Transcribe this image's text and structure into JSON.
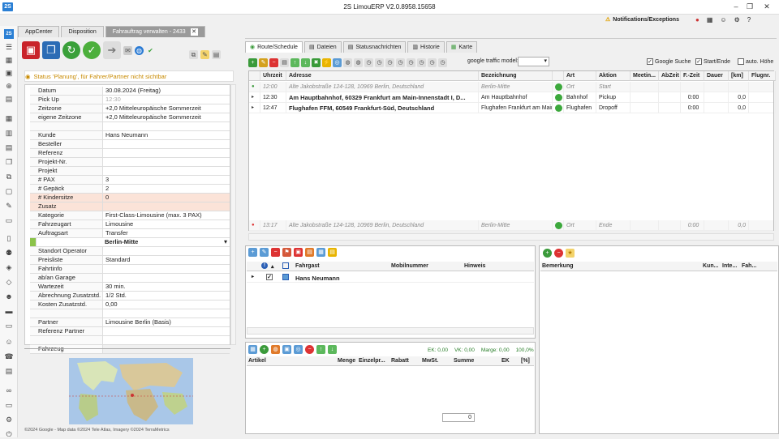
{
  "window": {
    "title": "2S LimouERP V2.0.8958.15658",
    "logo": "2S",
    "notif_label": "Notifications/Exceptions"
  },
  "tabs": [
    {
      "label": "AppCenter"
    },
    {
      "label": "Disposition"
    },
    {
      "label": "Fahrauftrag verwalten - 2433"
    }
  ],
  "status_text": "Status 'Planung', für Fahrer/Partner nicht sichtbar",
  "form": [
    {
      "label": "Datum",
      "value": "30.08.2024 (Freitag)"
    },
    {
      "label": "Pick Up",
      "value": "12:30",
      "style": "gray"
    },
    {
      "label": "Zeitzone",
      "value": "+2,0 Mitteleuropäische Sommerzeit"
    },
    {
      "label": "eigene Zeitzone",
      "value": "+2,0 Mitteleuropäische Sommerzeit"
    },
    {
      "label": "",
      "value": ""
    },
    {
      "label": "Kunde",
      "value": "Hans Neumann"
    },
    {
      "label": "Besteller",
      "value": ""
    },
    {
      "label": "Referenz",
      "value": ""
    },
    {
      "label": "Projekt-Nr.",
      "value": ""
    },
    {
      "label": "Projekt",
      "value": ""
    },
    {
      "label": "# PAX",
      "value": "3"
    },
    {
      "label": "# Gepäck",
      "value": "2"
    },
    {
      "label": "# Kindersitze",
      "value": "0",
      "style": "pink"
    },
    {
      "label": "Zusatz",
      "value": "",
      "style": "pink"
    },
    {
      "label": "Kategorie",
      "value": "First-Class-Limousine (max. 3 PAX)"
    },
    {
      "label": "Fahrzeugart",
      "value": "Limousine"
    },
    {
      "label": "Auftragsart",
      "value": "Transfer"
    },
    {
      "label": "",
      "value": "Berlin-Mitte",
      "style": "green"
    },
    {
      "label": "Standort Operator",
      "value": ""
    },
    {
      "label": "Preisliste",
      "value": "Standard"
    },
    {
      "label": "Fahrtinfo",
      "value": ""
    },
    {
      "label": "ab/an Garage",
      "value": ""
    },
    {
      "label": "Wartezeit",
      "value": "30 min."
    },
    {
      "label": "Abrechnung Zusatzstd.",
      "value": "1/2 Std."
    },
    {
      "label": "Kosten Zusatzstd.",
      "value": "0,00"
    },
    {
      "label": "",
      "value": ""
    },
    {
      "label": "Partner",
      "value": "Limousine Berlin (Basis)"
    },
    {
      "label": "Referenz Partner",
      "value": ""
    },
    {
      "label": "",
      "value": ""
    },
    {
      "label": "Fahrzeug",
      "value": ""
    }
  ],
  "map_copyright": "©2024 Google - Map data ©2024 Tele Atlas, Imagery ©2024 TerraMetrics",
  "right_tabs": [
    {
      "label": "Route/Schedule"
    },
    {
      "label": "Dateien"
    },
    {
      "label": "Statusnachrichten"
    },
    {
      "label": "Historie"
    },
    {
      "label": "Karte"
    }
  ],
  "traffic_label": "google traffic model:",
  "checkboxes": [
    {
      "label": "Google Suche",
      "checked": true
    },
    {
      "label": "Start/Ende",
      "checked": true
    },
    {
      "label": "auto. Höhe",
      "checked": false
    }
  ],
  "route_headers": [
    "Uhrzeit",
    "Adresse",
    "Bezeichnung",
    "Art",
    "Aktion",
    "Meetin...",
    "AbZeit",
    "F.-Zeit",
    "Dauer",
    "[km]",
    "Flugnr."
  ],
  "route_rows": [
    {
      "time": "12:00",
      "address": "Alte Jakobstraße 124-128, 10969 Berlin, Deutschland",
      "bez": "Berlin-Mitte",
      "art": "Ort",
      "aktion": "Start",
      "fzeit": "",
      "km": "",
      "style": "it"
    },
    {
      "time": "12:30",
      "address": "Am Hauptbahnhof, 60329 Frankfurt am Main-Innenstadt I, D...",
      "bez": "Am Hauptbahnhof",
      "art": "Bahnhof",
      "aktion": "Pickup",
      "fzeit": "0:00",
      "km": "0,0",
      "style": "bold"
    },
    {
      "time": "12:47",
      "address": "Flughafen FFM, 60549 Frankfurt-Süd, Deutschland",
      "bez": "Flughafen Frankfurt am Main",
      "art": "Flughafen",
      "aktion": "Dropoff",
      "fzeit": "0:00",
      "km": "0,0",
      "style": "bold"
    },
    {
      "time": "13:17",
      "address": "Alte Jakobstraße 124-128, 10969 Berlin, Deutschland",
      "bez": "Berlin-Mitte",
      "art": "Ort",
      "aktion": "Ende",
      "fzeit": "0:00",
      "km": "0,0",
      "style": "it"
    }
  ],
  "pax_headers": [
    "Fahrgast",
    "Mobilnummer",
    "Hinweis"
  ],
  "pax_rows": [
    {
      "name": "Hans Neumann"
    }
  ],
  "note_headers": [
    "Bemerkung",
    "Kun...",
    "Inte...",
    "Fah..."
  ],
  "ek": {
    "ek": "EK: 0,00",
    "vk": "VK: 0,00",
    "marge": "Marge: 0,00",
    "pct": "100,0%"
  },
  "article_headers": [
    "Artikel",
    "Menge",
    "Einzelpr...",
    "Rabatt",
    "MwSt.",
    "Summe",
    "EK",
    "[%]"
  ],
  "article_total": "0"
}
